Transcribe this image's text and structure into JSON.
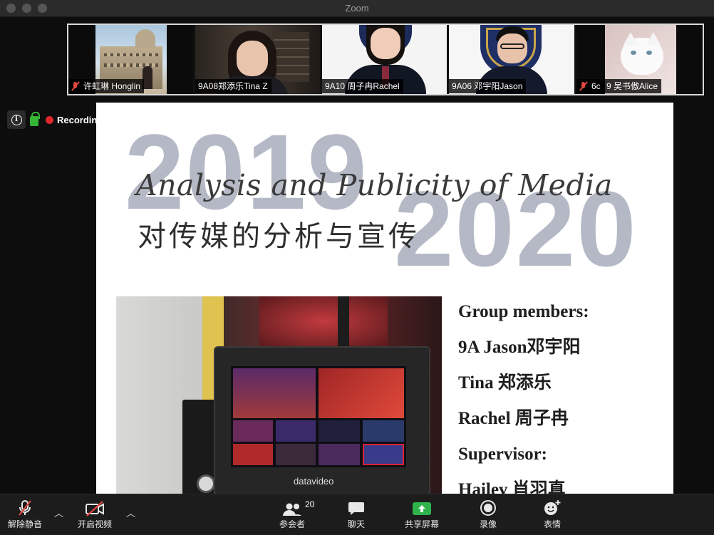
{
  "window": {
    "title": "Zoom"
  },
  "gallery": [
    {
      "name": "许虹琳 Honglin",
      "muted": true,
      "active": false
    },
    {
      "name": "9A08郑添乐Tina Z",
      "muted": false,
      "active": false
    },
    {
      "name": "9A10 周子冉Rachel",
      "muted": false,
      "active": true
    },
    {
      "name": "9A06 邓宇阳Jason",
      "muted": false,
      "active": false
    },
    {
      "name": "6c",
      "muted": true,
      "active": false
    },
    {
      "name": "9 吴书傲Alice",
      "muted": false,
      "active": false
    }
  ],
  "status": {
    "recording_label": "Recording"
  },
  "slide": {
    "year_start": "2019",
    "year_end": "2020",
    "title": "Analysis and Publicity of Media",
    "subtitle": "对传媒的分析与宣传",
    "photo_brand": "datavideo",
    "members": [
      "Group members:",
      "9A Jason邓宇阳",
      "Tina 郑添乐",
      "Rachel 周子冉",
      "Supervisor:",
      "Hailey 肖羽真"
    ]
  },
  "toolbar": {
    "unmute_label": "解除静音",
    "start_video_label": "开启视频",
    "participants_label": "参会者",
    "participants_count": "20",
    "chat_label": "聊天",
    "share_label": "共享屏幕",
    "record_label": "录像",
    "reactions_label": "表情"
  },
  "colors": {
    "accent_green": "#2fb24c",
    "mute_red": "#e0473e",
    "record_red": "#e0272b",
    "active_speaker": "#b5e46a",
    "year_gray": "#b5b9c6"
  }
}
